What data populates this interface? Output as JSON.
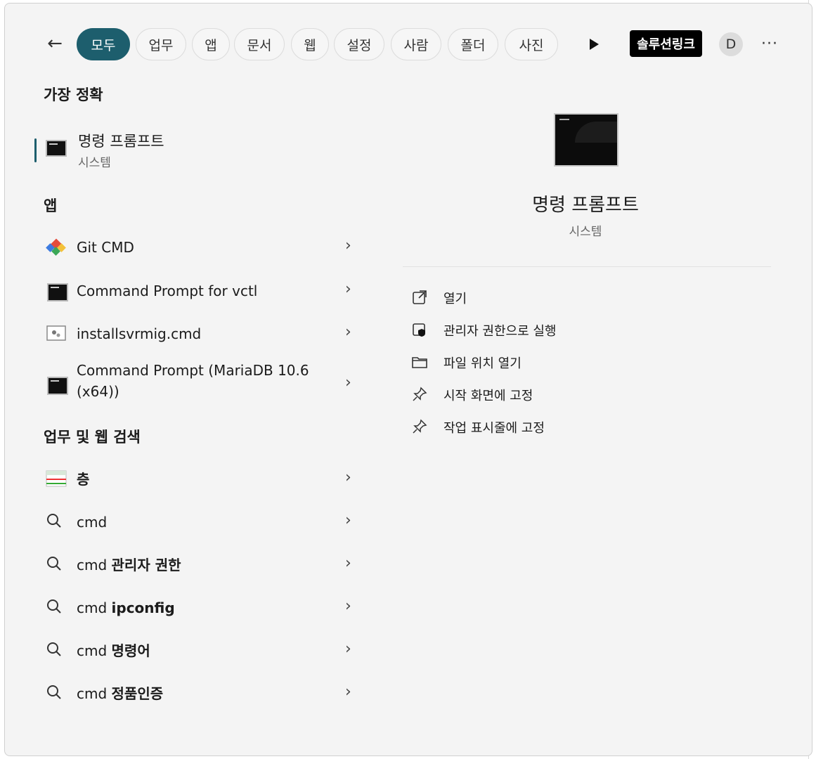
{
  "filters": {
    "back_label": "←",
    "tabs": [
      {
        "label": "모두",
        "active": true
      },
      {
        "label": "업무",
        "active": false
      },
      {
        "label": "앱",
        "active": false
      },
      {
        "label": "문서",
        "active": false
      },
      {
        "label": "웹",
        "active": false
      },
      {
        "label": "설정",
        "active": false
      },
      {
        "label": "사람",
        "active": false
      },
      {
        "label": "폴더",
        "active": false
      },
      {
        "label": "사진",
        "active": false
      }
    ],
    "org_label": "솔루션링크",
    "avatar_letter": "D",
    "more_label": "···"
  },
  "best_match": {
    "section_label": "가장 정확",
    "title": "명령 프롬프트",
    "subtitle": "시스템"
  },
  "apps": {
    "section_label": "앱",
    "items": [
      {
        "label": "Git CMD"
      },
      {
        "label": "Command Prompt for vctl"
      },
      {
        "label": "installsvrmig.cmd"
      },
      {
        "label_line1": "Command Prompt (MariaDB 10.6",
        "label_line2": "(x64))"
      }
    ]
  },
  "web": {
    "section_label": "업무 및 웹 검색",
    "items": [
      {
        "label": "층"
      },
      {
        "prefix": "cmd",
        "suffix": ""
      },
      {
        "prefix": "cmd ",
        "suffix": "관리자 권한"
      },
      {
        "prefix": "cmd ",
        "suffix": "ipconfig"
      },
      {
        "prefix": "cmd ",
        "suffix": "명령어"
      },
      {
        "prefix": "cmd ",
        "suffix": "정품인증"
      }
    ]
  },
  "detail": {
    "title": "명령 프롬프트",
    "subtitle": "시스템",
    "actions": [
      {
        "label": "열기",
        "icon": "open-external-icon"
      },
      {
        "label": "관리자 권한으로 실행",
        "icon": "shield-icon"
      },
      {
        "label": "파일 위치 열기",
        "icon": "folder-icon"
      },
      {
        "label": "시작 화면에 고정",
        "icon": "pin-icon"
      },
      {
        "label": "작업 표시줄에 고정",
        "icon": "pin-icon"
      }
    ]
  },
  "colors": {
    "accent": "#1d5e6d",
    "panel_bg": "#f4f4f4"
  }
}
